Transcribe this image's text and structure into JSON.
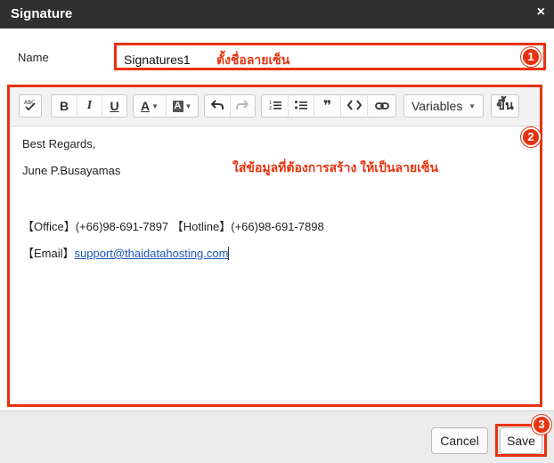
{
  "dialog": {
    "title": "Signature",
    "close_glyph": "×"
  },
  "name_field": {
    "label": "Name",
    "value": "Signatures1",
    "annotation": "ตั้งชื่อลายเซ็น"
  },
  "toolbar": {
    "spellcheck_icon": "spellcheck-icon",
    "bold": "B",
    "italic": "I",
    "underline": "U",
    "font_color": "A",
    "bg_color": "A",
    "undo": "↶",
    "redo": "↷",
    "ordered_list": "1≡",
    "bullet_list": "•≡",
    "blockquote": "99",
    "code": "<>",
    "link": "⊂⊃",
    "variables_label": "Variables",
    "up_label": "ขึ้น"
  },
  "editor": {
    "line1": "Best Regards,",
    "line2": "June P.Busayamas",
    "annotation": "ใส่ข้อมูลที่ต้องการสร้าง ให้เป็นลายเซ็น",
    "contact_line": "【Office】(+66)98-691-7897 【Hotline】(+66)98-691-7898",
    "email_prefix": "【Email】",
    "email_link": "support@thaidatahosting.com"
  },
  "badges": {
    "one": "1",
    "two": "2",
    "three": "3"
  },
  "footer": {
    "cancel_label": "Cancel",
    "save_label": "Save"
  },
  "colors": {
    "annotation_red": "#e8320e",
    "title_bar": "#2f2f2f",
    "link_blue": "#1a56b8"
  }
}
